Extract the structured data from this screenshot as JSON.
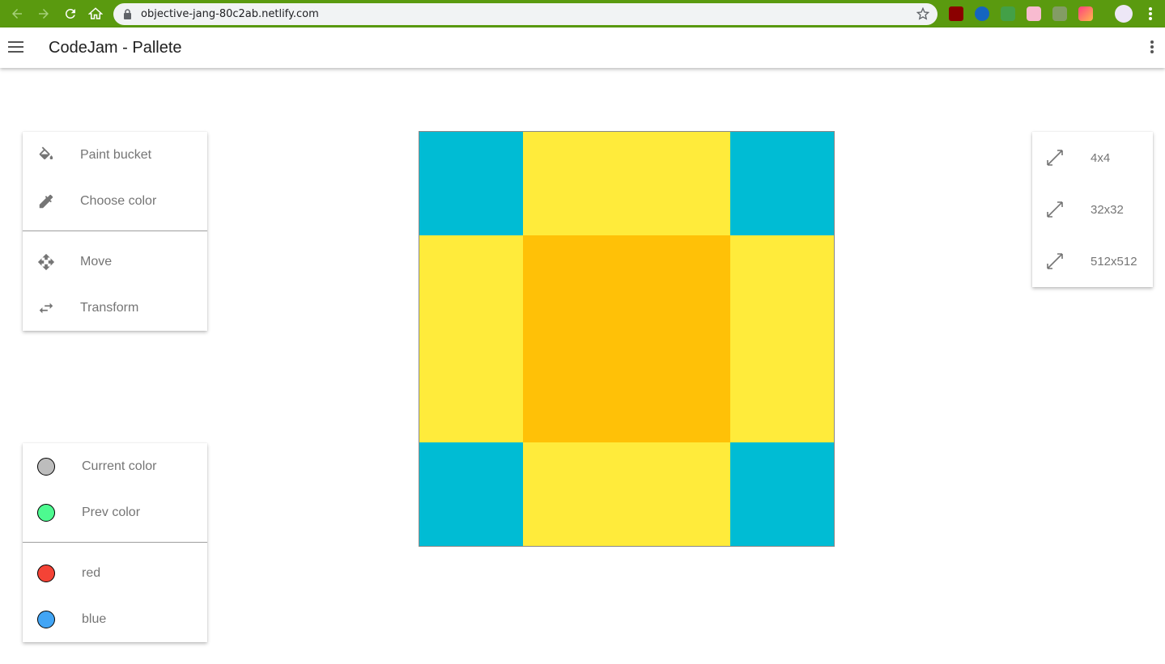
{
  "browser": {
    "url": "objective-jang-80c2ab.netlify.com"
  },
  "app": {
    "title": "CodeJam - Pallete"
  },
  "tools": {
    "items": [
      {
        "label": "Paint bucket",
        "icon": "paint-bucket-icon"
      },
      {
        "label": "Choose color",
        "icon": "eyedropper-icon"
      },
      {
        "label": "Move",
        "icon": "move-icon"
      },
      {
        "label": "Transform",
        "icon": "transform-icon"
      }
    ]
  },
  "colors": {
    "items": [
      {
        "label": "Current color",
        "color": "#bdbdbd"
      },
      {
        "label": "Prev color",
        "color": "#4dfa90"
      },
      {
        "label": "red",
        "color": "#f44336"
      },
      {
        "label": "blue",
        "color": "#42a5f5"
      }
    ]
  },
  "sizes": {
    "items": [
      {
        "label": "4x4",
        "icon": "resize-icon"
      },
      {
        "label": "32x32",
        "icon": "resize-icon"
      },
      {
        "label": "512x512",
        "icon": "resize-icon"
      }
    ]
  },
  "canvas": {
    "colors": {
      "cyan": "#00bcd4",
      "yellow": "#ffeb3b",
      "amber": "#ffc107"
    },
    "grid": [
      [
        "cyan",
        "yellow",
        "cyan"
      ],
      [
        "yellow",
        "amber",
        "yellow"
      ],
      [
        "cyan",
        "yellow",
        "cyan"
      ]
    ]
  }
}
